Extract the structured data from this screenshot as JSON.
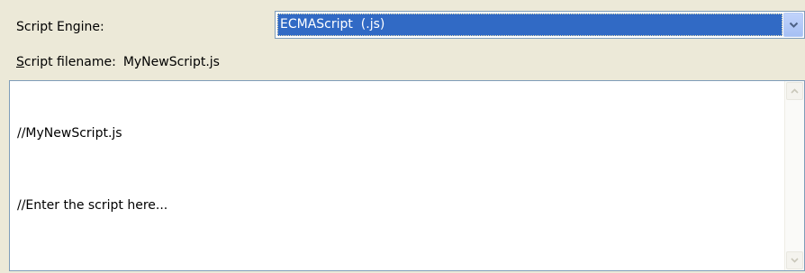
{
  "engine": {
    "label": "Script Engine:",
    "selected": "ECMAScript  (.js)",
    "dropdown_icon": "chevron-down-icon"
  },
  "filename": {
    "label_accel": "S",
    "label_rest": "cript filename:",
    "value": "MyNewScript.js"
  },
  "editor": {
    "lines": [
      "//MyNewScript.js",
      "//Enter the script here..."
    ],
    "scroll_up_icon": "scroll-up-arrow-icon",
    "scroll_down_icon": "scroll-down-arrow-icon"
  },
  "colors": {
    "background": "#ece9d8",
    "selection": "#316ac5",
    "border": "#7f9db9"
  }
}
